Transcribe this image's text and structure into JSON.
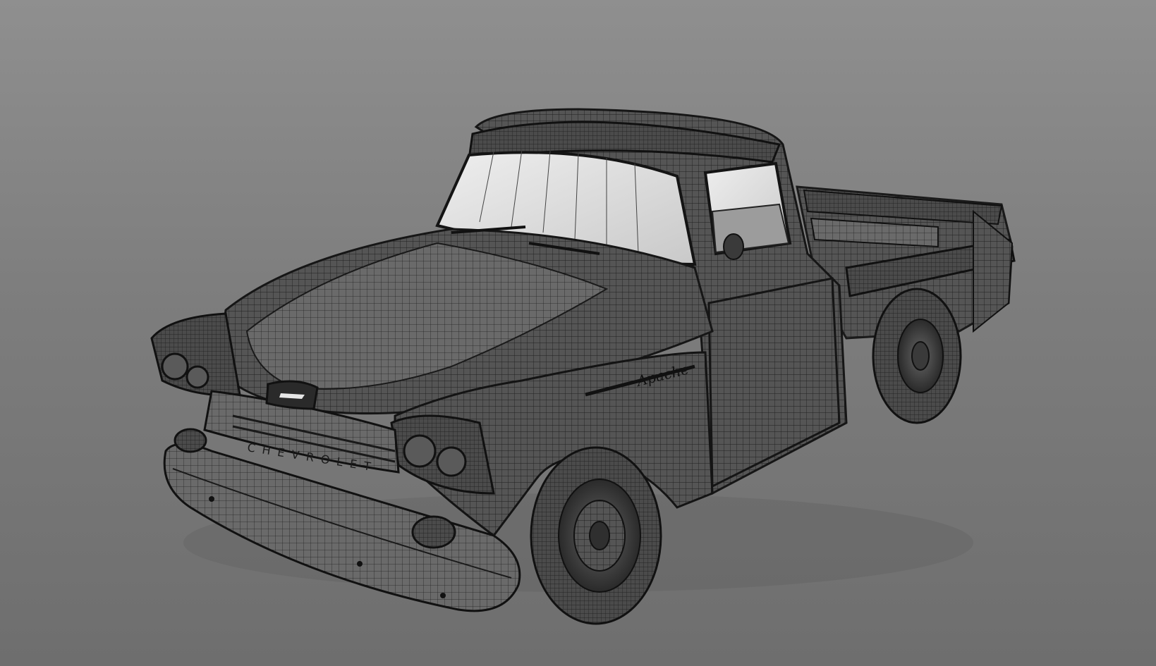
{
  "scene": {
    "subject": "pickup-truck-wireframe",
    "background_top": "#8f8f8f",
    "background_bottom": "#6e6e6e",
    "body_color": "#4a4a4a",
    "wire_color": "#1e1e1e",
    "glass_color": "#d8d8d8"
  },
  "badges": {
    "grille_lettering": "CHEVROLET",
    "fender_script": "Apache"
  }
}
